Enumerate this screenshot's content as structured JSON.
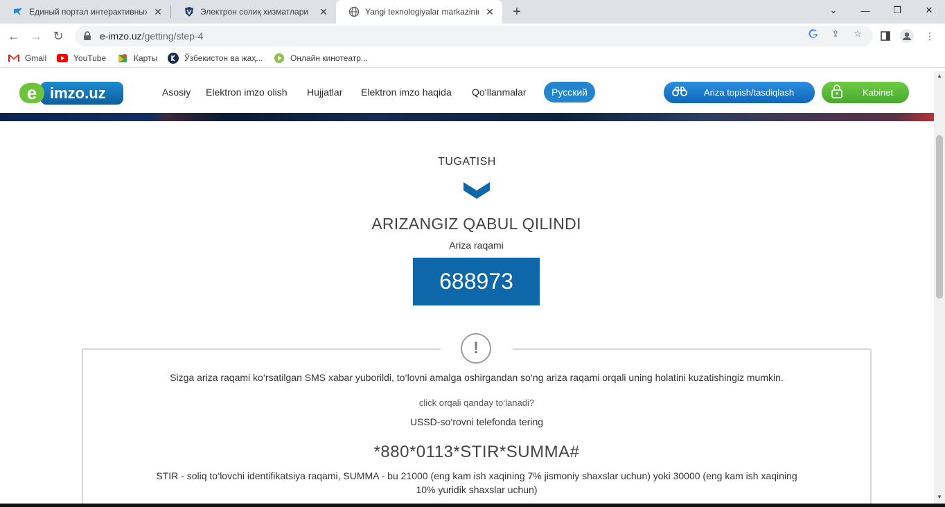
{
  "browser": {
    "tabs": [
      {
        "title": "Единый портал интерактивных",
        "icon": "bird-icon",
        "active": false
      },
      {
        "title": "Электрон солиқ хизматлари",
        "icon": "shield-icon",
        "active": false
      },
      {
        "title": "Yangi texnologiyalar markazining",
        "icon": "globe-icon",
        "active": true
      }
    ],
    "url_host": "e-imzo.uz",
    "url_path": "/getting/step-4",
    "bookmarks": [
      {
        "label": "Gmail",
        "icon": "gmail-icon"
      },
      {
        "label": "YouTube",
        "icon": "youtube-icon"
      },
      {
        "label": "Карты",
        "icon": "maps-icon"
      },
      {
        "label": "Ўзбекистон ва жаҳ...",
        "icon": "k-icon"
      },
      {
        "label": "Онлайн кинотеатр...",
        "icon": "play-icon"
      }
    ]
  },
  "site": {
    "logo": {
      "e": "e",
      "word": "imzo.uz"
    },
    "menu": [
      "Asosiy",
      "Elektron imzo olish",
      "Hujjatlar",
      "Elektron imzo haqida",
      "Qo‘llanmalar"
    ],
    "lang_button": "Русский",
    "find_button": "Ariza topish/tasdiqlash",
    "cabinet_button": "Kabinet"
  },
  "content": {
    "step_title": "TUGATISH",
    "accepted_title": "ARIZANGIZ QABUL QILINDI",
    "application_number_label": "Ariza raqami",
    "application_number": "688973",
    "info_icon": "!",
    "sms_text": "Sizga ariza raqami ko‘rsatilgan SMS xabar yuborildi, to‘lovni amalga oshirgandan so‘ng ariza raqami orqali uning holatini kuzatishingiz mumkin.",
    "click_question": "click orqali qanday to‘lanadi?",
    "ussd_text": "USSD-so‘rovni telefonda tering",
    "ussd_code": "*880*0113*STIR*SUMMA#",
    "stir_text": "STIR - soliq to‘lovchi identifikatsiya raqami, SUMMA - bu 21000 (eng kam ish xaqining 7% jismoniy shaxslar uchun) yoki 30000 (eng kam ish xaqining 10% yuridik shaxslar uchun)"
  },
  "colors": {
    "brand_blue": "#0d67a8",
    "brand_green": "#6ec33a",
    "lang_blue": "#2485cf"
  }
}
